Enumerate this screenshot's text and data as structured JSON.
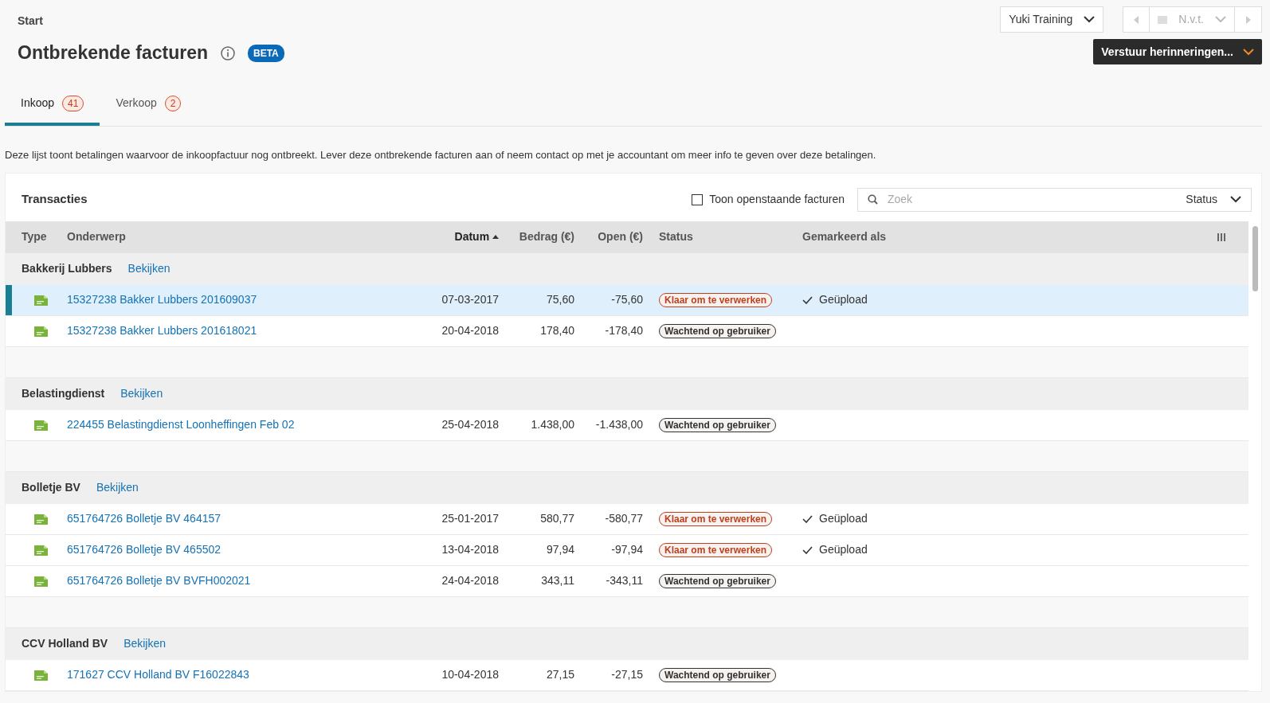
{
  "breadcrumb": "Start",
  "title": "Ontbrekende facturen",
  "badge": "BETA",
  "company_select": {
    "value": "Yuki Training"
  },
  "period_select": {
    "value": "N.v.t.",
    "disabled": true
  },
  "remind_button": "Verstuur herinneringen...",
  "tabs": [
    {
      "label": "Inkoop",
      "count": "41",
      "selected": true
    },
    {
      "label": "Verkoop",
      "count": "2",
      "selected": false
    }
  ],
  "description": "Deze lijst toont betalingen waarvoor de inkoopfactuur nog ontbreekt. Lever deze ontbrekende facturen aan of neem contact op met je accountant om meer info te geven over deze betalingen.",
  "panel_title": "Transacties",
  "open_invoices_checkbox": {
    "label": "Toon openstaande facturen",
    "checked": false
  },
  "search": {
    "placeholder": "Zoek"
  },
  "status_filter": "Status",
  "columns": [
    "Type",
    "Onderwerp",
    "Datum",
    "Bedrag (€)",
    "Open (€)",
    "Status",
    "Gemarkeerd als"
  ],
  "groups": [
    {
      "name": "Bakkerij Lubbers",
      "link": "Bekijken",
      "rows": [
        {
          "subject": "15327238 Bakker Lubbers 201609037",
          "date": "07-03-2017",
          "amount": "75,60",
          "open": "-75,60",
          "status": {
            "label": "Klaar om te verwerken",
            "color": "#c0401e"
          },
          "marked": "Geüpload",
          "selected": true
        },
        {
          "subject": "15327238 Bakker Lubbers 201618021",
          "date": "20-04-2018",
          "amount": "178,40",
          "open": "-178,40",
          "status": {
            "label": "Wachtend op gebruiker",
            "color": "#333333"
          },
          "selected": false
        }
      ]
    },
    {
      "name": "Belastingdienst",
      "link": "Bekijken",
      "rows": [
        {
          "subject": "224455 Belastingdienst Loonheffingen Feb 02",
          "date": "25-04-2018",
          "amount": "1.438,00",
          "open": "-1.438,00",
          "status": {
            "label": "Wachtend op gebruiker",
            "color": "#333333"
          },
          "selected": false
        }
      ]
    },
    {
      "name": "Bolletje BV",
      "link": "Bekijken",
      "rows": [
        {
          "subject": "651764726 Bolletje BV 464157",
          "date": "25-01-2017",
          "amount": "580,77",
          "open": "-580,77",
          "status": {
            "label": "Klaar om te verwerken",
            "color": "#c0401e"
          },
          "marked": "Geüpload",
          "selected": false
        },
        {
          "subject": "651764726 Bolletje BV 465502",
          "date": "13-04-2018",
          "amount": "97,94",
          "open": "-97,94",
          "status": {
            "label": "Klaar om te verwerken",
            "color": "#c0401e"
          },
          "marked": "Geüpload",
          "selected": false
        },
        {
          "subject": "651764726 Bolletje BV BVFH002021",
          "date": "24-04-2018",
          "amount": "343,11",
          "open": "-343,11",
          "status": {
            "label": "Wachtend op gebruiker",
            "color": "#333333"
          },
          "selected": false
        }
      ]
    },
    {
      "name": "CCV Holland BV",
      "link": "Bekijken",
      "rows": [
        {
          "subject": "171627 CCV Holland BV F16022843",
          "date": "10-04-2018",
          "amount": "27,15",
          "open": "-27,15",
          "status": {
            "label": "Wachtend op gebruiker",
            "color": "#333333"
          },
          "selected": false
        }
      ]
    }
  ]
}
